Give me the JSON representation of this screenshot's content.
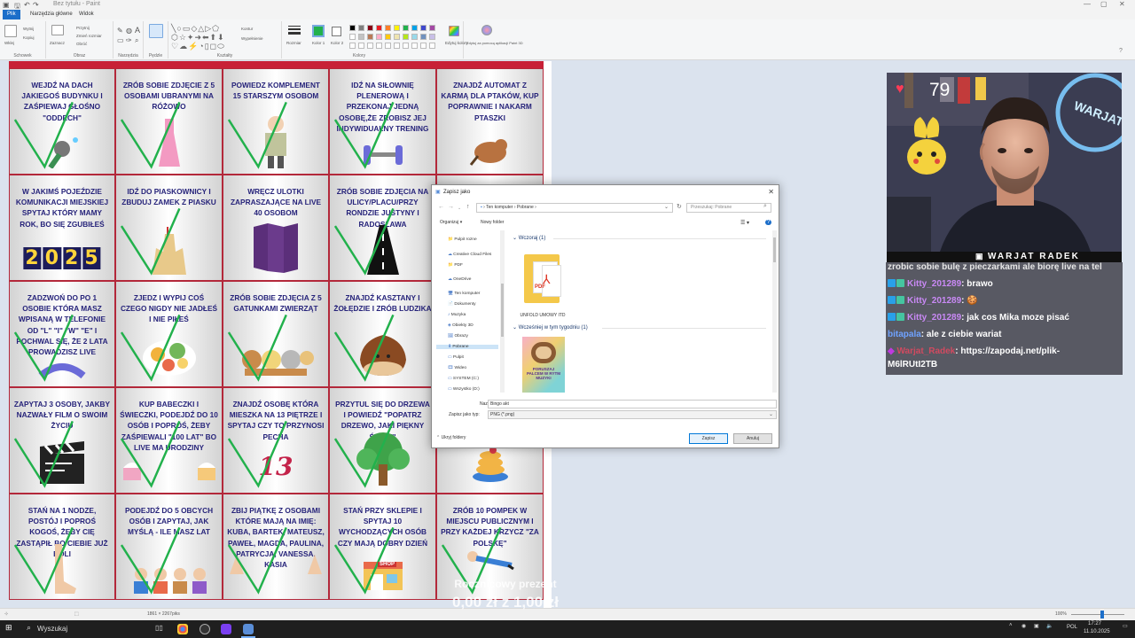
{
  "titlebar": {
    "title": "Bez tytułu - Paint"
  },
  "tabs": [
    "Plik",
    "Narzędzia główne",
    "Widok"
  ],
  "ribbon": {
    "groups": [
      "Schowek",
      "Obraz",
      "Narzędzia",
      "Pędzle",
      "Kształty",
      "Kolory"
    ],
    "clipboard": {
      "paste": "Wklej",
      "cut": "Wytnij",
      "copy": "Kopiuj"
    },
    "image": {
      "select": "Zaznacz",
      "crop": "Przytnij",
      "resize": "Zmień rozmiar",
      "rotate": "Obróć"
    },
    "shapes": {
      "outline": "Kontur",
      "fill": "Wypełnienie"
    },
    "size": "Rozmiar",
    "color1": "Kolor 1",
    "color2": "Kolor 2",
    "edit_colors": "Edytuj kolory",
    "paint3d": "Edytuj za pomocą aplikacji Paint 3D",
    "palette": [
      "#000000",
      "#7f7f7f",
      "#880015",
      "#ed1c24",
      "#ff7f27",
      "#fff200",
      "#22b14c",
      "#00a2e8",
      "#3f48cc",
      "#a349a4",
      "#ffffff",
      "#c3c3c3",
      "#b97a57",
      "#ffaec9",
      "#ffc90e",
      "#efe4b0",
      "#b5e61d",
      "#99d9ea",
      "#7092be",
      "#c8bfe7"
    ],
    "color1_value": "#22b14c",
    "color2_value": "#ffffff"
  },
  "bingo": [
    "WEJDŹ NA DACH JAKIEGOŚ BUDYNKU I ZAŚPIEWAJ GŁOŚNO \"ODDECH\"",
    "ZRÓB SOBIE ZDJĘCIE Z 5 OSOBAMI UBRANYMI NA RÓŻOWO",
    "POWIEDZ KOMPLEMENT 15 STARSZYM OSOBOM",
    "IDŹ NA SIŁOWNIĘ PLENEROWĄ I PRZEKONAJ JEDNĄ OSOBĘ,ŻE ZROBISZ JEJ INDYWIDUALNY TRENING",
    "ZNAJDŹ AUTOMAT Z KARMĄ DLA PTAKÓW, KUP POPRAWNIE I NAKARM PTASZKI",
    "W JAKIMŚ POJEŹDZIE KOMUNIKACJI MIEJSKIEJ SPYTAJ KTÓRY MAMY ROK, BO SIĘ ZGUBIŁEŚ",
    "IDŹ DO PIASKOWNICY I ZBUDUJ ZAMEK Z PIASKU",
    "WRĘCZ ULOTKI ZAPRASZAJĄCE NA LIVE 40 OSOBOM",
    "ZRÓB SOBIE ZDJĘCIA NA ULICY/PLACU/PRZY RONDZIE JUSTYNY I RADOSŁAWA",
    "",
    "ZADZWOŃ DO PO 1 OSOBIE KTÓRA MASZ WPISANĄ W TELEFONIE OD \"L\" \"I\" \"W\" \"E\" I POCHWAL SIĘ, ŻE 2 LATA PROWADZISZ LIVE",
    "ZJEDZ I WYPIJ COŚ CZEGO NIGDY NIE JADŁEŚ I NIE PIŁEŚ",
    "ZRÓB SOBIE ZDJĘCIA Z 5 GATUNKAMI ZWIERZĄT",
    "ZNAJDŹ KASZTANY I ŻOŁĘDZIE I ZRÓB LUDZIKA",
    "",
    "ZAPYTAJ 3 OSOBY, JAKBY NAZWAŁY FILM O SWOIM ŻYCIU",
    "KUP BABECZKI I ŚWIECZKI, PODEJDŹ DO 10 OSÓB I POPROŚ, ŻEBY ZAŚPIEWALI \"100 LAT\" BO LIVE MA URODZINY",
    "ZNAJDŹ OSOBĘ KTÓRA MIESZKA NA 13 PIĘTRZE I SPYTAJ CZY TO PRZYNOSI PECHA",
    "PRZYTUL SIĘ DO DRZEWA I POWIEDŹ \"POPATRZ DRZEWO, JAKI PIĘKNY ŚWIAT\"",
    "",
    "STAŃ NA 1 NODZE, POSTÓJ I POPROŚ KOGOŚ, ŻEBY CIĘ ZASTĄPIŁ BO CIEBIE JUŻ BOLI",
    "PODEJDŹ DO 5 OBCYCH OSÓB I ZAPYTAJ, JAK MYŚLĄ - ILE MASZ LAT",
    "ZBIJ PIĄTKĘ Z OSOBAMI KTÓRE MAJĄ NA IMIĘ: KUBA, BARTEK, MATEUSZ, PAWEŁ, MAGDA, PAULINA, PATRYCJA, VANESSA, KASIA",
    "STAŃ PRZY SKLEPIE I SPYTAJ 10 WYCHODZĄCYCH OSÓB CZY MAJĄ DOBRY DZIEŃ",
    "ZRÓB 10 POMPEK W MIEJSCU PUBLICZNYM I PRZY KAŻDEJ KRZYCZ \"ZA POLSKĘ\""
  ],
  "bingo_extra": {
    "year": "2025",
    "number13": "13",
    "shop": "SHOP",
    "pdf": "PDF"
  },
  "dialog": {
    "title": "Zapisz jako",
    "breadcrumb": "›  Ten komputer  ›  Pobrane  ›",
    "search_placeholder": "Przeszukaj: Pobrane",
    "organize": "Organizuj ▾",
    "new_folder": "Nowy folder",
    "nav": [
      "Pulpit rozne",
      "Creative Cloud Files",
      "PDF",
      "OneDrive",
      "Ten komputer",
      "Dokumenty",
      "Muzyka",
      "Obiekty 3D",
      "Obrazy",
      "Pobrane",
      "Pulpit",
      "Wideo",
      "SYSTEM (C:)",
      "Wszystko (D:)"
    ],
    "group1": "Wczoraj (1)",
    "group2": "Wcześniej w tym tygodniu (1)",
    "file1": "UNFOLD UMOWY ITD",
    "file2_caption": "PORUSZAJ PALCEM W RYTM MUZYKI",
    "filename_label": "Nazwa pliku:",
    "filename_value": "Bingo akt",
    "filetype_label": "Zapisz jako typ:",
    "filetype_value": "PNG (*.png)",
    "hide_folders": "Ukryj foldery",
    "save": "Zapisz",
    "cancel": "Anuluj"
  },
  "webcam": {
    "heart_rate": "79",
    "channel": "WARJAT RADEK"
  },
  "chat": [
    {
      "user": "",
      "text": "zrobic sobie bulę z pieczarkami ale biorę live na tel"
    },
    {
      "user": "Kitty_201289",
      "text": ": brawo"
    },
    {
      "user": "Kitty_201289",
      "text": ": 🍪"
    },
    {
      "user": "Kitty_201289",
      "text": ": jak cos Mika moze pisać"
    },
    {
      "user": "bitapala",
      "text": ": ale z ciebie wariat"
    },
    {
      "user": "Warjat_Radek",
      "text": ": https://zapodaj.net/plik-"
    },
    {
      "user": "",
      "text": "M6lRUtI2TB"
    }
  ],
  "donation": {
    "line1": "Rocznicowy prezent",
    "line2": "0,00 zł z 1,00 zł"
  },
  "statusbar": {
    "size": "1861 × 2267piks",
    "zoom": "100%"
  },
  "taskbar": {
    "search": "Wyszukaj",
    "lang": "POL",
    "time": "17:27",
    "date": "11.10.2025"
  }
}
